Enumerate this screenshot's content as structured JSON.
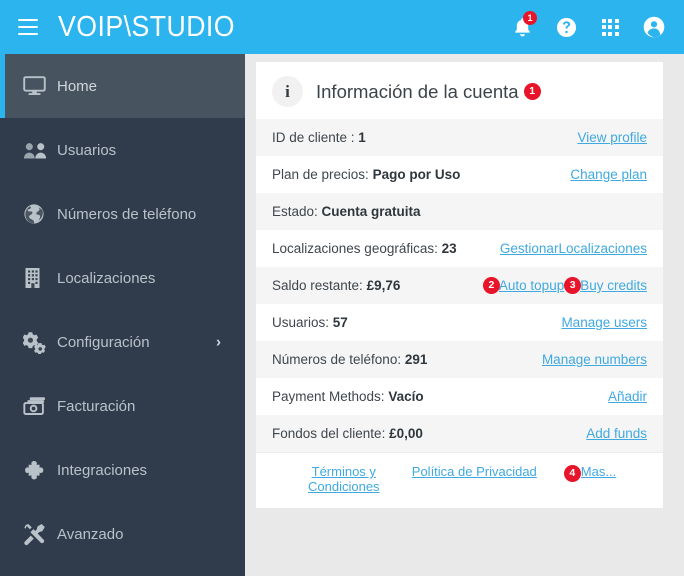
{
  "topbar": {
    "menu_icon": "hamburger-icon",
    "logo": "VOIP\\STUDIO",
    "notifications": {
      "icon": "bell-icon",
      "badge": "1"
    },
    "help": {
      "icon": "help-circle-icon"
    },
    "apps": {
      "icon": "apps-grid-icon"
    },
    "account": {
      "icon": "account-circle-icon"
    },
    "accent_color": "#2cb4ef"
  },
  "sidebar": {
    "background_color": "#303c4b",
    "active_color": "#47535f",
    "items": [
      {
        "label": "Home",
        "icon": "monitor-icon",
        "active": true,
        "caret": ""
      },
      {
        "label": "Usuarios",
        "icon": "users-icon",
        "active": false,
        "caret": ""
      },
      {
        "label": "Números de teléfono",
        "icon": "globe-icon",
        "active": false,
        "caret": ""
      },
      {
        "label": "Localizaciones",
        "icon": "building-icon",
        "active": false,
        "caret": ""
      },
      {
        "label": "Configuración",
        "icon": "gears-icon",
        "active": false,
        "caret": "›"
      },
      {
        "label": "Facturación",
        "icon": "banknotes-icon",
        "active": false,
        "caret": ""
      },
      {
        "label": "Integraciones",
        "icon": "puzzle-icon",
        "active": false,
        "caret": ""
      },
      {
        "label": "Avanzado",
        "icon": "tools-icon",
        "active": false,
        "caret": ""
      }
    ]
  },
  "card": {
    "icon": "info-icon",
    "title": "Información de la cuenta",
    "title_badge": "1",
    "badge_color": "#e8142a",
    "link_color": "#3fa9e0",
    "rows": [
      {
        "label": "ID de cliente : ",
        "value": "1",
        "links": [
          {
            "text": "View profile",
            "badge": ""
          }
        ]
      },
      {
        "label": "Plan de precios: ",
        "value": "Pago por Uso",
        "links": [
          {
            "text": "Change plan",
            "badge": ""
          }
        ]
      },
      {
        "label": "Estado: ",
        "value": "Cuenta gratuita",
        "links": []
      },
      {
        "label": "Localizaciones geográficas: ",
        "value": "23",
        "links": [
          {
            "text": "Gestionar",
            "badge": ""
          },
          {
            "text": "Localizaciones",
            "badge": ""
          }
        ]
      },
      {
        "label": "Saldo restante: ",
        "value": "£9,76",
        "links": [
          {
            "text": "Auto topup",
            "badge": "2"
          },
          {
            "text": "Buy credits",
            "badge": "3"
          }
        ]
      },
      {
        "label": "Usuarios: ",
        "value": "57",
        "links": [
          {
            "text": "Manage users",
            "badge": ""
          }
        ]
      },
      {
        "label": "Números de teléfono: ",
        "value": "291",
        "links": [
          {
            "text": "Manage numbers",
            "badge": ""
          }
        ]
      },
      {
        "label": "Payment Methods: ",
        "value": "Vacío",
        "links": [
          {
            "text": "Añadir",
            "badge": ""
          }
        ]
      },
      {
        "label": "Fondos del cliente: ",
        "value": "£0,00",
        "links": [
          {
            "text": "Add funds",
            "badge": ""
          }
        ]
      }
    ],
    "footer_links": [
      {
        "text": "Términos y Condiciones",
        "badge": ""
      },
      {
        "text": "Política de Privacidad",
        "badge": ""
      },
      {
        "text": "Mas...",
        "badge": "4"
      }
    ]
  }
}
